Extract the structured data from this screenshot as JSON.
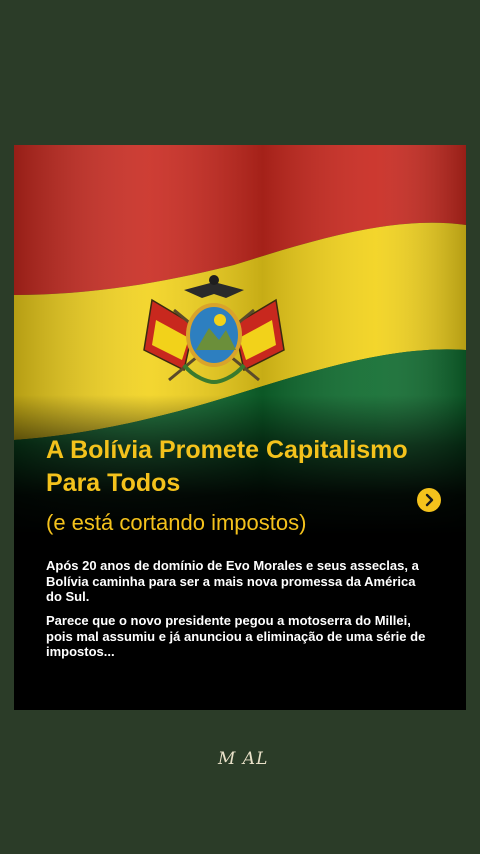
{
  "post": {
    "title": "A Bolívia Promete Capitalismo Para Todos",
    "subtitle": "(e está cortando impostos)",
    "paragraph_1": "Após 20 anos de domínio de Evo Morales e seus asseclas, a Bolívia caminha  para ser a mais nova promessa da América do Sul.",
    "paragraph_2": "Parece que o novo presidente pegou a motoserra do Millei, pois mal  assumiu e já anunciou a eliminação de uma série de impostos..."
  },
  "branding": {
    "signature": "M AL"
  },
  "icons": {
    "next": "chevron-right-icon",
    "coat_of_arms": "bolivia-coat-of-arms-icon"
  },
  "colors": {
    "background": "#2b3c28",
    "accent": "#f4c21c",
    "flag_red": "#c8281e",
    "flag_yellow": "#f2d21a",
    "flag_green": "#0e6b2e"
  }
}
